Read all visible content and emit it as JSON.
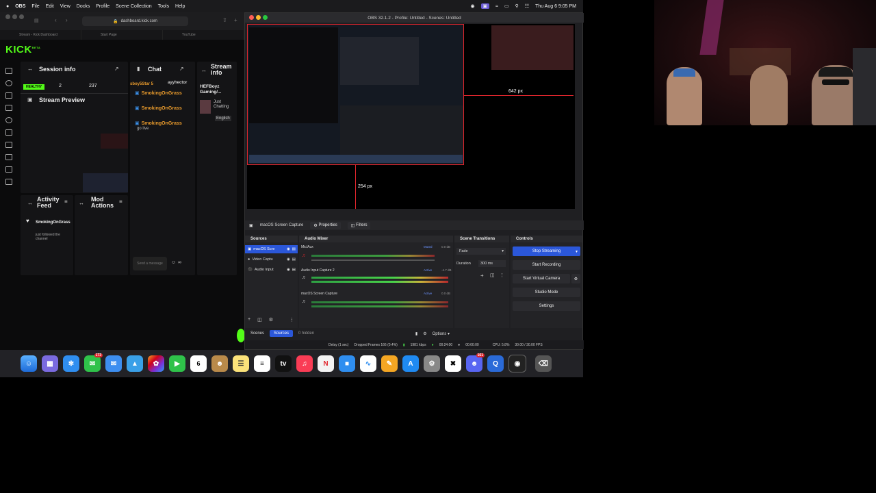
{
  "menubar": {
    "apple": "",
    "app": "OBS",
    "items": [
      "File",
      "Edit",
      "View",
      "Docks",
      "Profile",
      "Scene Collection",
      "Tools",
      "Help"
    ],
    "clock": "Thu Aug 6  9:05 PM"
  },
  "browser": {
    "url": "dashboard.kick.com",
    "tabs": [
      "Stream - Kick Dashboard",
      "Start Page",
      "YouTube"
    ]
  },
  "kick": {
    "logo": "KICK",
    "logo_badge": "BETA",
    "session": {
      "title": "Session info",
      "health": "HEALTHY",
      "viewers": "2",
      "followers": "237"
    },
    "preview_title": "Stream Preview",
    "chat": {
      "title": "Chat",
      "header_users": "sboy5Star 5",
      "header_user2": "ayyhector",
      "messages": [
        {
          "user": "SmokingOnGrass",
          "text": ""
        },
        {
          "user": "SmokingOnGrass",
          "text": ""
        },
        {
          "user": "SmokingOnGrass",
          "text": "go live"
        }
      ],
      "send_placeholder": "Send a message"
    },
    "stream_info": {
      "title": "Stream info",
      "name": "HEFBoyz Gaming/...",
      "category": "Just Chatting",
      "language": "English"
    },
    "activity": {
      "title": "Activity Feed",
      "user": "SmokingOnGrass",
      "text": "just followed the channel"
    },
    "mod": {
      "title": "Mod Actions"
    }
  },
  "obs": {
    "title": "OBS 32.1.2 - Profile: Untitled - Scenes: Untitled",
    "preview": {
      "label_right": "642 px",
      "label_bottom": "254 px"
    },
    "source_bar": {
      "source": "macOS Screen Capture",
      "properties": "Properties",
      "filters": "Filters"
    },
    "sources": {
      "title": "Sources",
      "items": [
        "macOS Scre",
        "Video Captu",
        "Audio Input"
      ]
    },
    "mixer": {
      "title": "Audio Mixer",
      "channels": [
        {
          "name": "Mic/Aux",
          "status": "Muted",
          "db": "0.0 dB"
        },
        {
          "name": "Audio Input Capture 2",
          "status": "Active",
          "db": "-4.7 dB"
        },
        {
          "name": "macOS Screen Capture",
          "status": "Active",
          "db": "0.0 dB"
        }
      ]
    },
    "transitions": {
      "title": "Scene Transitions",
      "type": "Fade",
      "duration_label": "Duration",
      "duration": "300 ms"
    },
    "controls": {
      "title": "Controls",
      "stop_streaming": "Stop Streaming",
      "start_recording": "Start Recording",
      "start_virtual": "Start Virtual Camera",
      "studio_mode": "Studio Mode",
      "settings": "Settings"
    },
    "bottom_tabs": {
      "scenes": "Scenes",
      "sources": "Sources",
      "hidden": "0 hidden",
      "options": "Options"
    },
    "status": {
      "delay": "Delay (1 sec)",
      "dropped": "Dropped Frames 166 (0.4%)",
      "bitrate": "1981 kbps",
      "stream_time": "00:24:00",
      "rec_time": "00:00:00",
      "cpu": "CPU: 5.8%",
      "fps": "30.00 / 30.00 FPS"
    }
  },
  "dock": {
    "calendar_day": "6",
    "badge_messages": "173",
    "badge_discord": "161"
  },
  "colors": {
    "kick_green": "#53fc18",
    "obs_accent": "#2b57d9",
    "selection_red": "#e0262d"
  }
}
